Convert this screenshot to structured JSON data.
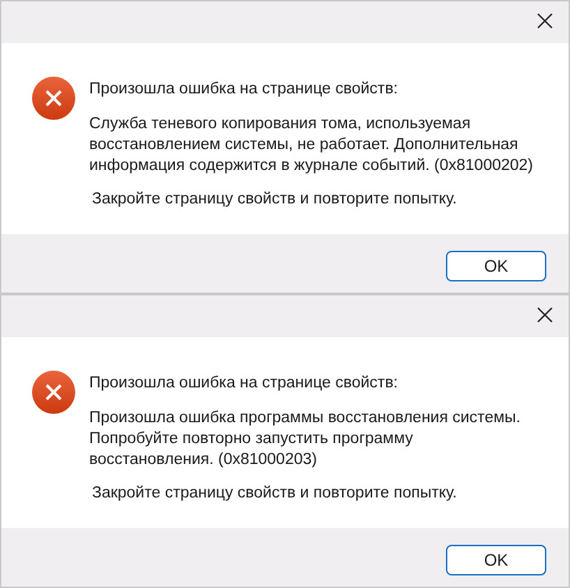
{
  "dialogs": [
    {
      "heading": "Произошла ошибка на странице свойств:",
      "message": "Служба теневого копирования тома, используемая\nвосстановлением системы, не работает. Дополнительная\nинформация содержится в журнале событий. (0x81000202)",
      "hint": "Закройте страницу свойств и повторите попытку.",
      "button": "OK"
    },
    {
      "heading": "Произошла ошибка на странице свойств:",
      "message": "Произошла ошибка программы восстановления системы.\nПопробуйте повторно запустить программу\nвосстановления. (0x81000203)",
      "hint": "Закройте страницу свойств и повторите попытку.",
      "button": "OK"
    }
  ]
}
